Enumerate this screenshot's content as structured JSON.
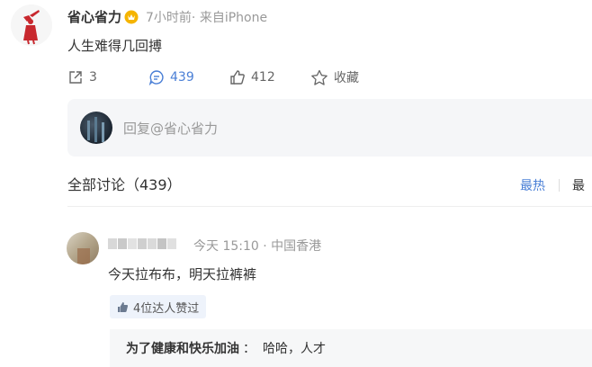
{
  "post": {
    "username": "省心省力",
    "meta": "7小时前· 来自iPhone",
    "text": "人生难得几回搏",
    "actions": {
      "share_count": "3",
      "comment_count": "439",
      "like_count": "412",
      "favorite_label": "收藏"
    }
  },
  "reply_box": {
    "placeholder": "回复@省心省力"
  },
  "discussion": {
    "title": "全部讨论（439）",
    "sort_hot": "最热",
    "sort_newest": "最"
  },
  "comments": [
    {
      "meta": "今天 15:10 · 中国香港",
      "text": "今天拉布布，明天拉裤裤",
      "likes_badge": "4位达人赞过",
      "sub_reply": {
        "user": "为了健康和快乐加油",
        "colon": "：",
        "text": "哈哈，人才"
      }
    }
  ],
  "colors": {
    "accent": "#4a7fd6",
    "avatar_red": "#c8282e",
    "vip_gold": "#f5b400"
  },
  "icons": [
    "share-icon",
    "comment-icon",
    "like-icon",
    "star-icon",
    "vip-icon",
    "thumb-up-icon"
  ]
}
